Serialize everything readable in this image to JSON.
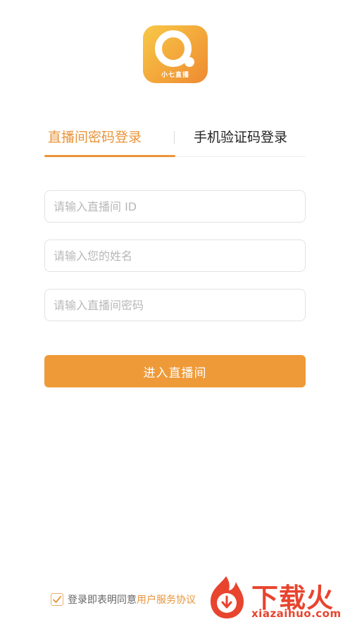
{
  "logo": {
    "label": "小七直播",
    "colors": {
      "top": "#f7c948",
      "bottom": "#ee8a32"
    }
  },
  "tabs": [
    {
      "label": "直播间密码登录",
      "active": true
    },
    {
      "label": "手机验证码登录",
      "active": false
    }
  ],
  "form": {
    "room_id_placeholder": "请输入直播间 ID",
    "name_placeholder": "请输入您的姓名",
    "password_placeholder": "请输入直播间密码",
    "submit_label": "进入直播间"
  },
  "agreement": {
    "checked": true,
    "prefix": "登录即表明同意",
    "link": "用户服务协议"
  },
  "watermark": {
    "title": "下载火",
    "domain": "xiazaihuo.com"
  },
  "colors": {
    "accent": "#ef9a38",
    "watermark": "#e8442e"
  }
}
